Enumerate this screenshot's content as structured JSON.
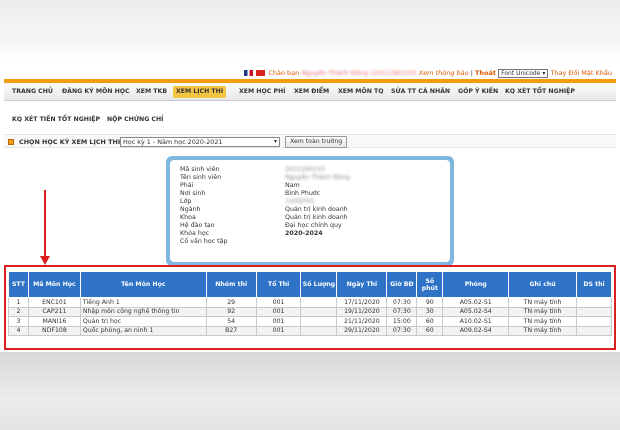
{
  "topbar": {
    "greeting": "Chào bạn",
    "student_name": "Nguyễn Thành Đông",
    "student_id": "(2011190133)",
    "view_notifications": "Xem thông báo",
    "separator": "|",
    "logout": "Thoát",
    "font_select": "Font Unicode",
    "change_password": "Thay Đổi Mật Khẩu"
  },
  "menu": {
    "items": [
      "TRANG CHỦ",
      "ĐĂNG KÝ MÔN HỌC",
      "XEM TKB",
      "XEM LỊCH THI",
      "XEM HỌC PHÍ",
      "XEM ĐIỂM",
      "XEM MÔN TQ",
      "SỬA TT CÁ NHÂN",
      "GÓP Ý KIẾN",
      "KQ XÉT TỐT NGHIỆP"
    ],
    "row2": [
      "KQ XÉT TIẾN TỐT NGHIỆP",
      "NỘP CHỨNG CHỈ"
    ]
  },
  "semester": {
    "label": "CHỌN HỌC KỲ XEM LỊCH THI",
    "selected": "Học kỳ 1 - Năm học 2020-2021",
    "button": "Xem toàn trường"
  },
  "student_info": [
    {
      "key": "Mã sinh viên",
      "value": "2011190133"
    },
    {
      "key": "Tên sinh viên",
      "value": "Nguyễn Thành Đông"
    },
    {
      "key": "Phái",
      "value": "Nam"
    },
    {
      "key": "Nơi sinh",
      "value": "Bình Phước"
    },
    {
      "key": "Lớp",
      "value": "11DQT01"
    },
    {
      "key": "Ngành",
      "value": "Quản trị kinh doanh"
    },
    {
      "key": "Khoa",
      "value": "Quản trị kinh doanh"
    },
    {
      "key": "Hệ đào tạo",
      "value": "Đại học chính quy"
    },
    {
      "key": "Khóa học",
      "value": "2020-2024"
    },
    {
      "key": "Cố vấn học tập",
      "value": ""
    }
  ],
  "table": {
    "headers": [
      "STT",
      "Mã Môn Học",
      "Tên Môn Học",
      "Nhóm thi",
      "Tổ Thi",
      "Số Lượng",
      "Ngày Thi",
      "Giờ BĐ",
      "Số phút",
      "Phòng",
      "Ghi chú",
      "DS thi"
    ],
    "rows": [
      [
        "1",
        "ENC101",
        "Tiếng Anh 1",
        "29",
        "001",
        "",
        "17/11/2020",
        "07:30",
        "90",
        "A05.02-S1",
        "TN máy tính",
        ""
      ],
      [
        "2",
        "CAP211",
        "Nhập môn công nghệ thông tin",
        "92",
        "001",
        "",
        "19/11/2020",
        "07:30",
        "30",
        "A05.02-S4",
        "TN máy tính",
        ""
      ],
      [
        "3",
        "MANI16",
        "Quản trị học",
        "54",
        "001",
        "",
        "21/11/2020",
        "15:00",
        "60",
        "A10.02-S1",
        "TN máy tính",
        ""
      ],
      [
        "4",
        "NDF108",
        "Quốc phòng, an ninh 1",
        "B27",
        "001",
        "",
        "29/11/2020",
        "07:30",
        "60",
        "A09.02-S4",
        "TN máy tính",
        ""
      ]
    ]
  },
  "colors": {
    "accent_orange": "#f39c12",
    "header_blue": "#2f73c6",
    "highlight_red": "#d9201f",
    "info_border": "#7fb8de"
  }
}
